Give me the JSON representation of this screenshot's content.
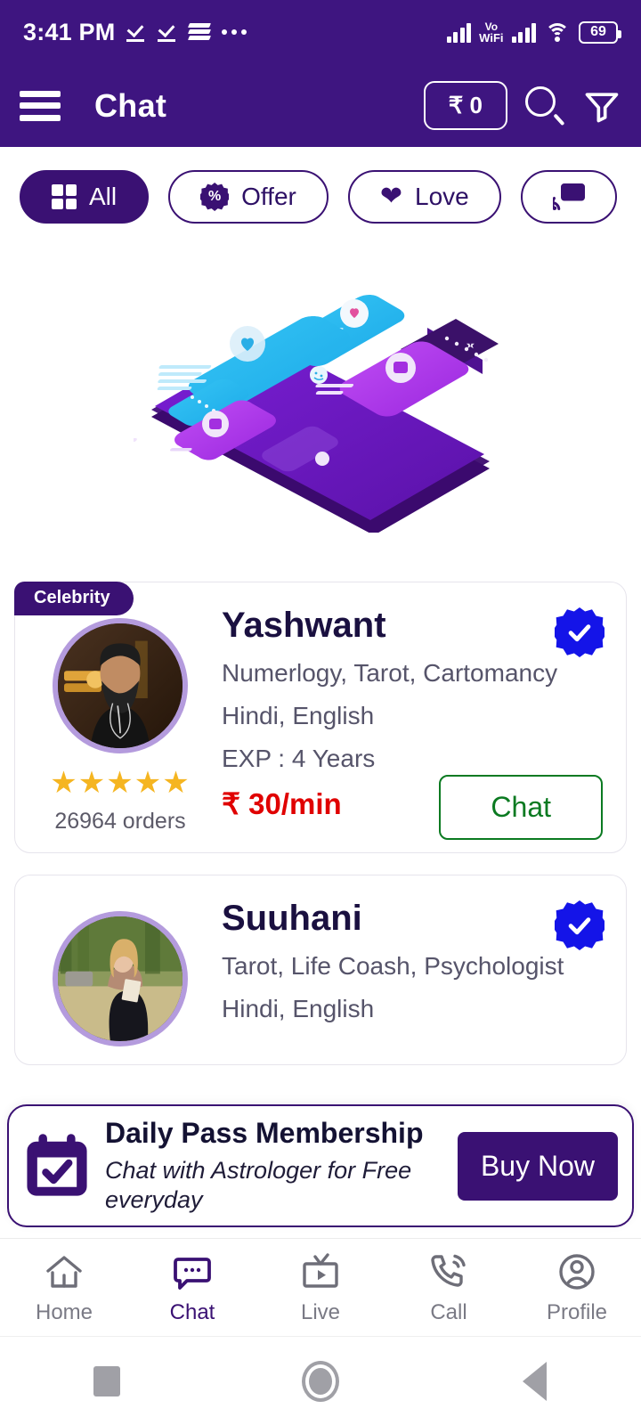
{
  "status_bar": {
    "time": "3:41 PM",
    "left_icons": [
      "check-mark-icon",
      "check-mark-icon",
      "layers-icon",
      "more-dots-icon"
    ],
    "network_label_top": "Vo",
    "network_label_bottom": "WiFi",
    "battery_percent": "69",
    "right_icons": [
      "signal-bars-icon",
      "volte-wifi-icon",
      "signal-bars-icon",
      "wifi-icon",
      "battery-icon"
    ]
  },
  "app_bar": {
    "title": "Chat",
    "menu_icon": "hamburger-menu-icon",
    "wallet_label": "₹ 0",
    "search_icon": "search-icon",
    "filter_icon": "filter-funnel-icon"
  },
  "filter_chips": [
    {
      "label": "All",
      "icon": "grid-icon",
      "active": true
    },
    {
      "label": "Offer",
      "icon": "discount-percent-icon",
      "active": false
    },
    {
      "label": "Love",
      "icon": "heart-icon",
      "active": false
    },
    {
      "label": "",
      "icon": "cast-live-icon",
      "active": false
    }
  ],
  "banner": {
    "illustration": "chat-phone-illustration"
  },
  "astrologers": [
    {
      "badge": "Celebrity",
      "name": "Yashwant",
      "skills": "Numerlogy, Tarot, Cartomancy",
      "languages": "Hindi, English",
      "experience": "EXP : 4 Years",
      "price": "₹ 30/min",
      "rating": "★★★★★",
      "orders": "26964 orders",
      "action_label": "Chat",
      "verified": true
    },
    {
      "badge": "",
      "name": "Suuhani",
      "skills": "Tarot, Life Coash, Psychologist",
      "languages": "Hindi, English",
      "experience": "",
      "price": "",
      "rating": "",
      "orders": "",
      "action_label": "",
      "verified": true
    }
  ],
  "daily_pass": {
    "icon": "calendar-check-icon",
    "title": "Daily Pass Membership",
    "subtitle": "Chat with Astrologer for Free everyday",
    "cta_label": "Buy Now"
  },
  "bottom_nav": [
    {
      "label": "Home",
      "icon": "home-icon",
      "active": false
    },
    {
      "label": "Chat",
      "icon": "chat-bubble-icon",
      "active": true
    },
    {
      "label": "Live",
      "icon": "tv-play-icon",
      "active": false
    },
    {
      "label": "Call",
      "icon": "phone-call-icon",
      "active": false
    },
    {
      "label": "Profile",
      "icon": "person-circle-icon",
      "active": false
    }
  ],
  "system_nav": {
    "recents_icon": "square-recents-icon",
    "home_icon": "circle-home-icon",
    "back_icon": "triangle-back-icon"
  },
  "colors": {
    "brand_purple": "#3E1580",
    "chip_purple": "#3A1173",
    "verified_blue": "#1414E8",
    "price_red": "#E00000",
    "chat_green": "#0B7A21",
    "star_gold": "#F5B521",
    "avatar_ring": "#B49BDD"
  }
}
